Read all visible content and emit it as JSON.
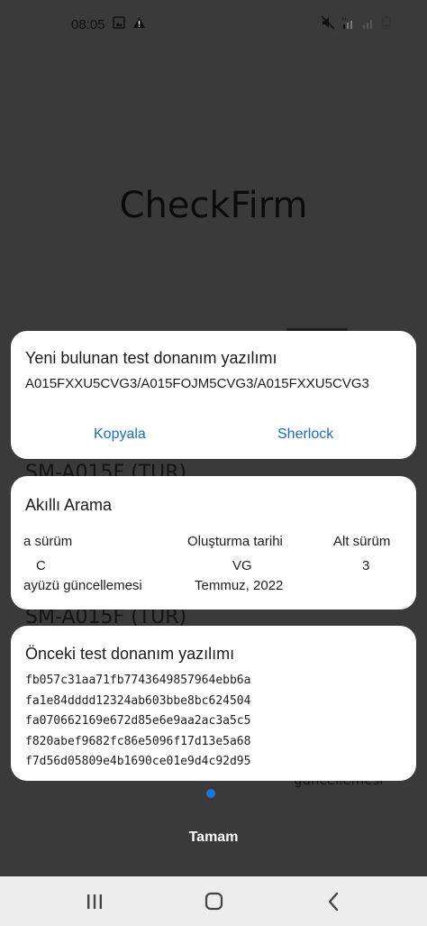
{
  "status_bar": {
    "time": "08:05"
  },
  "background": {
    "app_title": "CheckFirm",
    "model_label_1": "SM-A015F (TUR)",
    "model_label_2": "SM-A015F (TUR)",
    "partial_text": "güncellemesi"
  },
  "new_test_firmware": {
    "title": "Yeni bulunan test donanım yazılımı",
    "firmware": "A015FXXU5CVG3/A015FOJM5CVG3/A015FXXU5CVG3",
    "copy_label": "Kopyala",
    "sherlock_label": "Sherlock"
  },
  "smart_search": {
    "title": "Akıllı Arama",
    "headers": [
      "a sürüm",
      "Oluşturma tarihi",
      "Alt sürüm"
    ],
    "values": [
      "C",
      "VG",
      "3"
    ],
    "row2": [
      "ayüzü güncellemesi",
      "Temmuz, 2022"
    ]
  },
  "previous_test_firmware": {
    "title": "Önceki test donanım yazılımı",
    "hashes": [
      "fb057c31aa71fb7743649857964ebb6a",
      "fa1e84dddd12324ab603bbe8bc624504",
      "fa070662169e672d85e6e9aa2ac3a5c5",
      "f820abef9682fc86e5096f17d13e5a68",
      "f7d56d05809e4b1690ce01e9d4c92d95"
    ]
  },
  "footer": {
    "done_label": "Tamam"
  },
  "colors": {
    "accent": "#1e6bb8",
    "page_dot": "#1e73d9",
    "scrim": "#3a3a3a",
    "card": "#ffffff"
  }
}
